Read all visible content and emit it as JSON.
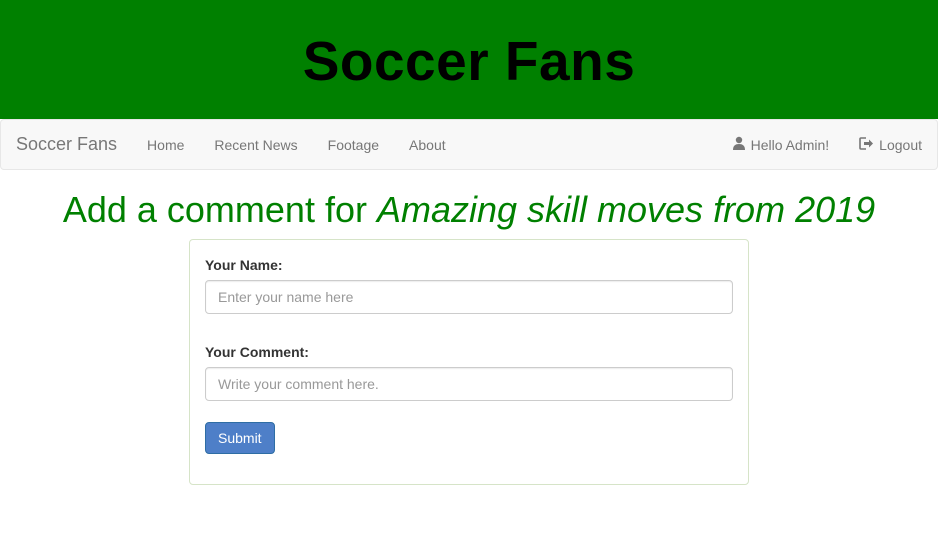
{
  "banner": {
    "title": "Soccer Fans"
  },
  "navbar": {
    "brand": "Soccer Fans",
    "links": [
      {
        "label": "Home"
      },
      {
        "label": "Recent News"
      },
      {
        "label": "Footage"
      },
      {
        "label": "About"
      }
    ],
    "user": {
      "label": "Hello Admin!",
      "icon": "user-icon"
    },
    "logout": {
      "label": "Logout",
      "icon": "logout-icon"
    }
  },
  "headline": {
    "prefix": "Add a comment for ",
    "subject": "Amazing skill moves from 2019"
  },
  "form": {
    "name_label": "Your Name:",
    "name_placeholder": "Enter your name here",
    "name_value": "",
    "comment_label": "Your Comment:",
    "comment_placeholder": "Write your comment here.",
    "comment_value": "",
    "submit_label": "Submit"
  },
  "colors": {
    "banner_bg": "#008000",
    "headline": "#008000",
    "button": "#4e7fc8"
  }
}
